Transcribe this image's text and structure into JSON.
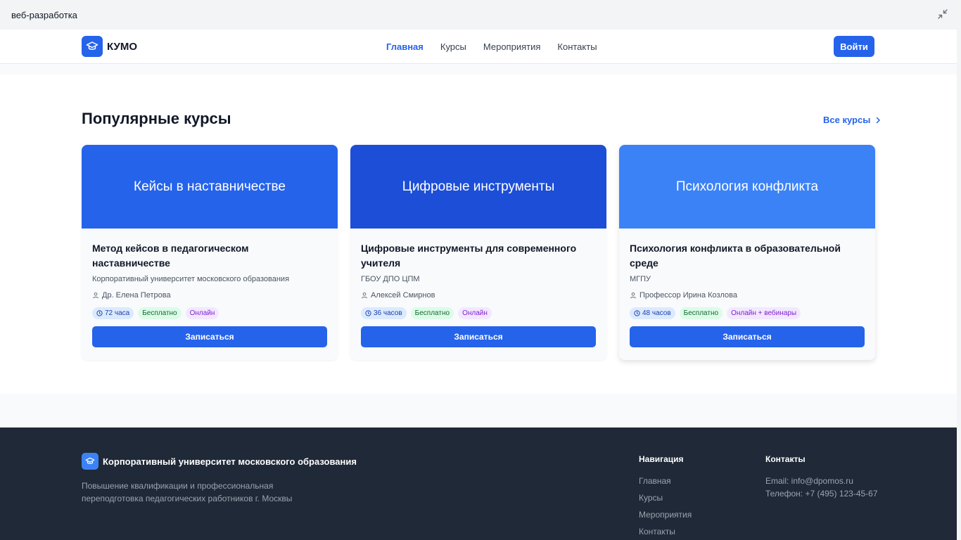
{
  "window": {
    "title": "веб-разработка"
  },
  "header": {
    "brand": "КУМО",
    "nav": [
      "Главная",
      "Курсы",
      "Мероприятия",
      "Контакты"
    ],
    "login_label": "Войти"
  },
  "section": {
    "title": "Популярные курсы",
    "all_courses_label": "Все курсы"
  },
  "courses": [
    {
      "banner": "Кейсы в наставничестве",
      "banner_color": "#2563eb",
      "title": "Метод кейсов в педагогическом наставничестве",
      "org": "Корпоративный университет московского образования",
      "author": "Др. Елена Петрова",
      "hours": "72 часа",
      "price": "Бесплатно",
      "mode": "Онлайн",
      "button": "Записаться"
    },
    {
      "banner": "Цифровые инструменты",
      "banner_color": "#1d4ed8",
      "title": "Цифровые инструменты для современного учителя",
      "org": "ГБОУ ДПО ЦПМ",
      "author": "Алексей Смирнов",
      "hours": "36 часов",
      "price": "Бесплатно",
      "mode": "Онлайн",
      "button": "Записаться"
    },
    {
      "banner": "Психология конфликта",
      "banner_color": "#3b82f6",
      "title": "Психология конфликта в образовательной среде",
      "org": "МГПУ",
      "author": "Профессор Ирина Козлова",
      "hours": "48 часов",
      "price": "Бесплатно",
      "mode": "Онлайн + вебинары",
      "button": "Записаться"
    }
  ],
  "footer": {
    "brand": "Корпоративный университет московского образования",
    "description_line1": "Повышение квалификации и профессиональная",
    "description_line2": "переподготовка педагогических работников г. Москвы",
    "nav_title": "Навигация",
    "nav": [
      "Главная",
      "Курсы",
      "Мероприятия",
      "Контакты"
    ],
    "contacts_title": "Контакты",
    "email": "Email: info@dpomos.ru",
    "phone": "Телефон: +7 (495) 123-45-67"
  },
  "colors": {
    "accent": "#2563eb",
    "footer_bg": "#1f2937"
  }
}
